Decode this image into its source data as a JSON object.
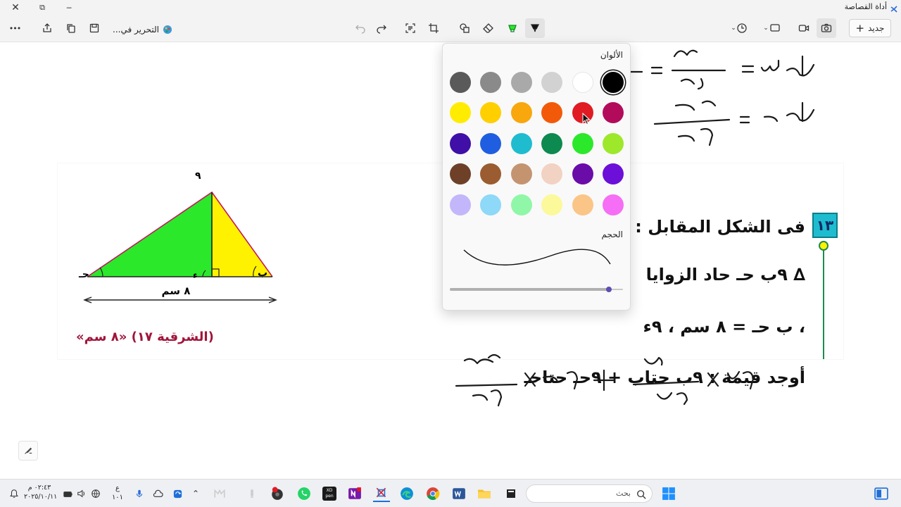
{
  "app": {
    "title": "أداة القصاصة",
    "caption_minimize": "─",
    "caption_restore": "⧉",
    "caption_close": "✕"
  },
  "toolbar": {
    "new_label": "جديد",
    "edit_in_label": "التحرير في...",
    "more_label": "•••"
  },
  "palette": {
    "colors_title": "الألوان",
    "size_title": "الحجم",
    "size_value": 0.95,
    "selected_color": "#000000",
    "rows": [
      [
        "#5a5a5a",
        "#8a8a8a",
        "#a9a9a9",
        "#d2d2d2",
        "#ffffff",
        "#000000"
      ],
      [
        "#ffec00",
        "#ffcf00",
        "#f8a70c",
        "#f25a0a",
        "#e01b24",
        "#b30b5c"
      ],
      [
        "#3f0fa7",
        "#1f5ee0",
        "#1fbccf",
        "#0d8a4f",
        "#2be82b",
        "#9de82b"
      ],
      [
        "#6e4027",
        "#9a5c30",
        "#c49470",
        "#f2d2c2",
        "#6a0ca8",
        "#6c0fd8"
      ],
      [
        "#c4b6fb",
        "#8ed8f8",
        "#8ff7a7",
        "#fbf99a",
        "#fbc587",
        "#f56ef5"
      ]
    ]
  },
  "worksheet": {
    "question_number": "١٣",
    "heading": "فى الشكل المقابل :",
    "line1": "∆ ٩ب حـ حاد الزوايا",
    "line2": "، ب حـ = ٨ سم ، ٩ء",
    "line3": "أوجد قيمة : ٩ب حتاب + ٩حـ حتاحـ",
    "source": "(الشرقية ١٧) «٨ سم»",
    "figure_base_label": "٨ سم",
    "vertex_a": "٩",
    "vertex_b": "ب",
    "vertex_c": "حـ",
    "vertex_d": "ء"
  },
  "taskbar": {
    "search_placeholder": "بحث",
    "time": "٠٢:٤٣ م",
    "date": "٢٠٢٥/١٠/١١",
    "lang": "ع",
    "lang2": "١٠١"
  }
}
